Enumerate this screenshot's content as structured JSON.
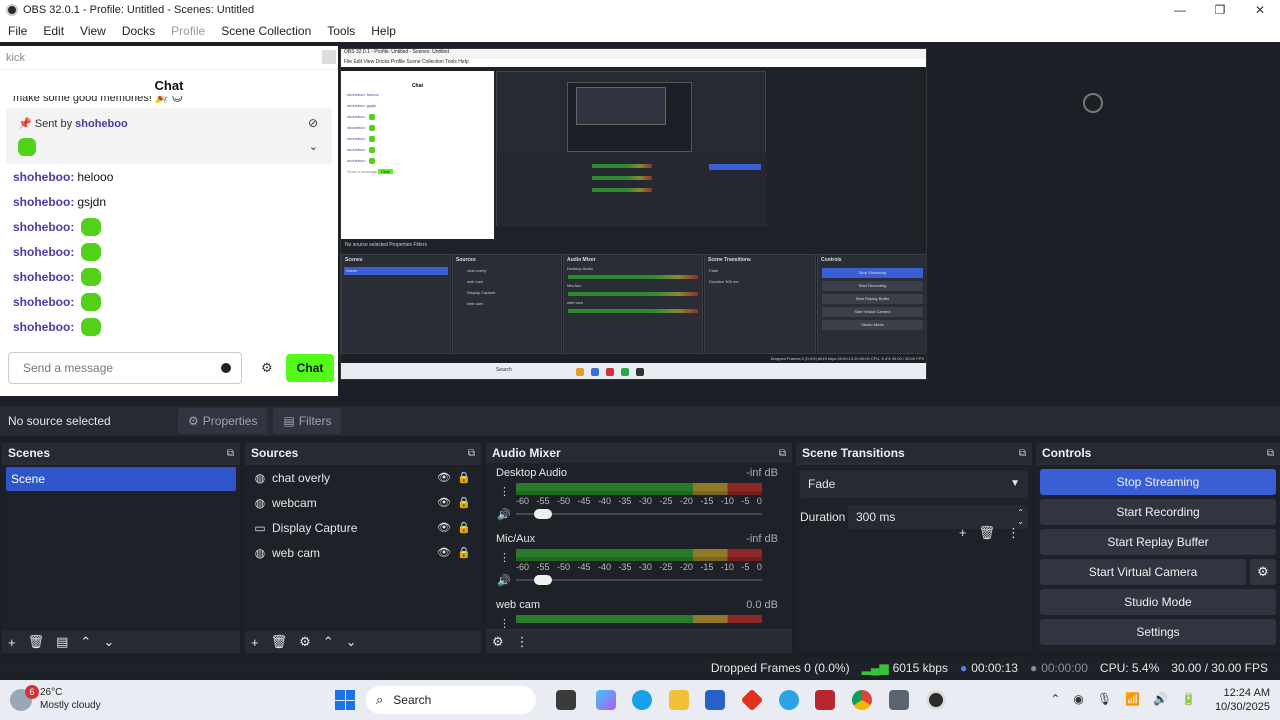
{
  "window": {
    "title": "OBS 32.0.1 - Profile: Untitled - Scenes: Untitled",
    "controls": [
      "—",
      "❐",
      "✕"
    ]
  },
  "menu": [
    "File",
    "Edit",
    "View",
    "Docks",
    "Profile",
    "Scene Collection",
    "Tools",
    "Help"
  ],
  "kick_dock": {
    "title": "kick",
    "chat_header": "Chat",
    "memory_text": "make some good memories! 🎉 😊",
    "pinned": {
      "prefix": "Sent by",
      "user": "shoheboo"
    },
    "messages": [
      {
        "user": "shoheboo:",
        "text": "helooo"
      },
      {
        "user": "shoheboo:",
        "text": "gsjdn"
      },
      {
        "user": "shoheboo:",
        "text": ""
      },
      {
        "user": "shoheboo:",
        "text": ""
      },
      {
        "user": "shoheboo:",
        "text": ""
      },
      {
        "user": "shoheboo:",
        "text": ""
      },
      {
        "user": "shoheboo:",
        "text": ""
      }
    ],
    "input_placeholder": "Send a message",
    "chat_button": "Chat"
  },
  "preview_mock": {
    "title": "OBS 32.0.1 - Profile: Untitled - Scenes: Untitled",
    "menu": "File  Edit  View  Docks  Profile  Scene Collection  Tools  Help",
    "chat": "Chat",
    "chat_lines": [
      "shoheboo: helooo",
      "shoheboo: gsjdn",
      "shoheboo:",
      "shoheboo:",
      "shoheboo:",
      "shoheboo:",
      "shoheboo:"
    ],
    "send": "Send a message",
    "chat_btn": "Chat",
    "no_source": "No source selected",
    "properties": "Properties",
    "filters": "Filters",
    "docks": [
      "Scenes",
      "Sources",
      "Audio Mixer",
      "Scene Transitions",
      "Controls"
    ],
    "scene": "Scene",
    "sources": [
      "chat overly",
      "web cam",
      "Display Capture",
      "web cam"
    ],
    "mixer": [
      "Desktop Audio",
      "Mic/Aux",
      "web cam"
    ],
    "trans": "Fade",
    "duration": "Duration",
    "duration_val": "300 ms",
    "controls": [
      "Stop Streaming",
      "Start Recording",
      "Start Replay Buffer",
      "Start Virtual Camera",
      "Studio Mode",
      "Settings"
    ],
    "status": "Dropped Frames 0 (0.0%)   6015 kbps   00:00:13   00:00:00   CPU: 5.4%   30.00 / 30.00 FPS",
    "search": "Search"
  },
  "props_bar": {
    "no_source": "No source selected",
    "properties": "Properties",
    "filters": "Filters"
  },
  "scenes": {
    "title": "Scenes",
    "items": [
      "Scene"
    ]
  },
  "sources": {
    "title": "Sources",
    "items": [
      {
        "name": "chat overly",
        "icon": "globe-icon"
      },
      {
        "name": "webcam",
        "icon": "globe-icon"
      },
      {
        "name": "Display Capture",
        "icon": "monitor-icon"
      },
      {
        "name": "web cam",
        "icon": "globe-icon"
      }
    ]
  },
  "mixer": {
    "title": "Audio Mixer",
    "scale": [
      "-60",
      "-55",
      "-50",
      "-45",
      "-40",
      "-35",
      "-30",
      "-25",
      "-20",
      "-15",
      "-10",
      "-5",
      "0"
    ],
    "channels": [
      {
        "name": "Desktop Audio",
        "db": "-inf dB"
      },
      {
        "name": "Mic/Aux",
        "db": "-inf dB"
      },
      {
        "name": "web cam",
        "db": "0.0 dB"
      }
    ]
  },
  "transitions": {
    "title": "Scene Transitions",
    "selected": "Fade",
    "duration_label": "Duration",
    "duration_value": "300 ms"
  },
  "controls": {
    "title": "Controls",
    "buttons": [
      "Stop Streaming",
      "Start Recording",
      "Start Replay Buffer",
      "Start Virtual Camera",
      "Studio Mode",
      "Settings"
    ]
  },
  "status": {
    "dropped": "Dropped Frames 0 (0.0%)",
    "kbps": "6015 kbps",
    "stream_time": "00:00:13",
    "rec_time": "00:00:00",
    "cpu": "CPU: 5.4%",
    "fps": "30.00 / 30.00 FPS"
  },
  "taskbar": {
    "weather_badge": "6",
    "temp": "26°C",
    "condition": "Mostly cloudy",
    "search": "Search",
    "time": "12:24 AM",
    "date": "10/30/2025"
  },
  "colors": {
    "accent_blue": "#3a5fd4",
    "kick_green": "#53fc18",
    "username_purple": "#4a3aa8"
  }
}
